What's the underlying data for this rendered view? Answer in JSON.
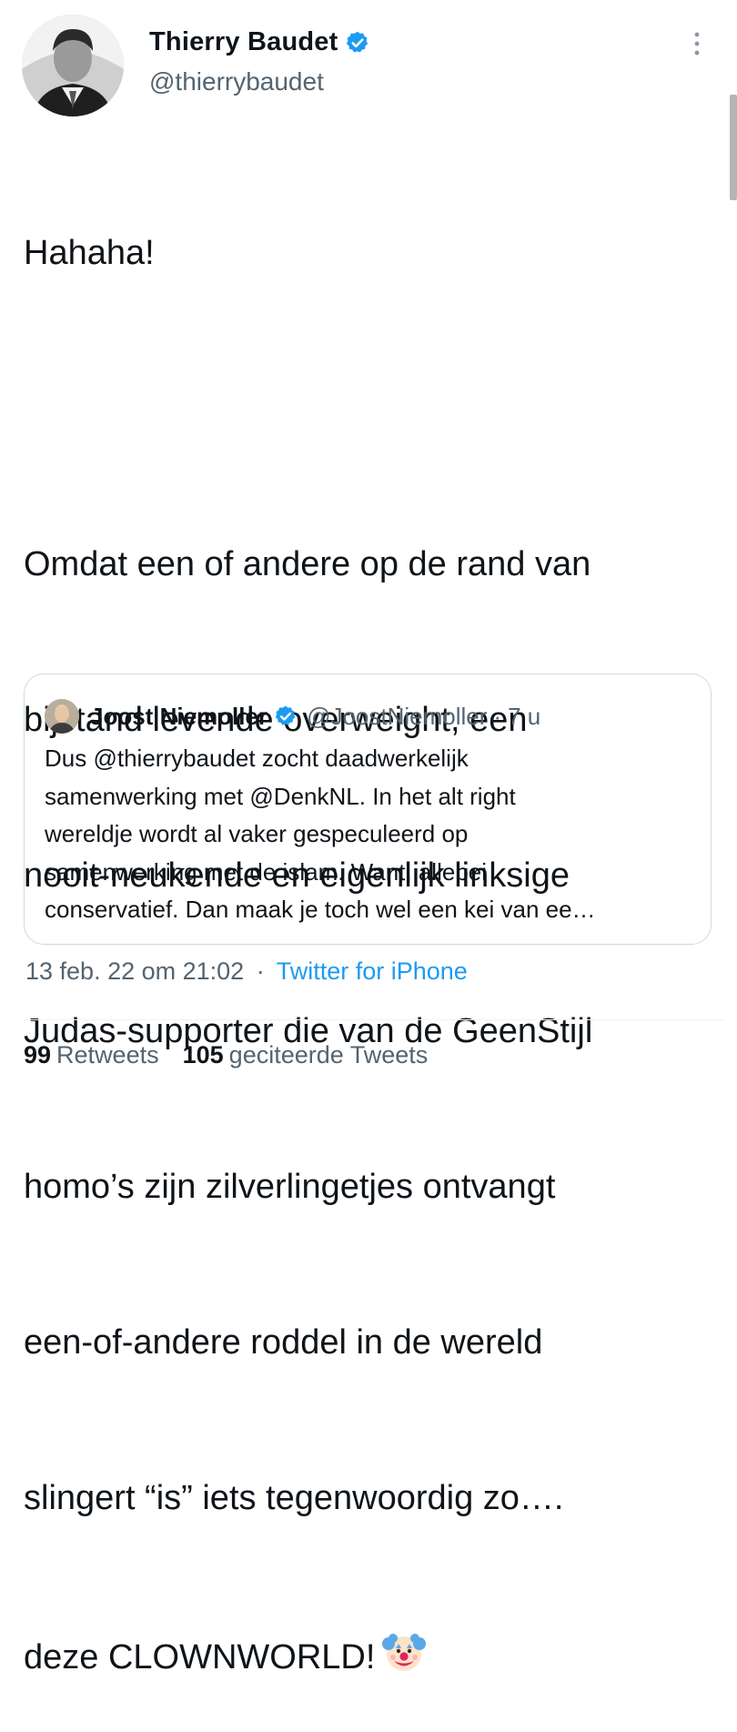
{
  "author": {
    "name": "Thierry Baudet",
    "handle": "@thierrybaudet",
    "verified": true,
    "avatar_icon": "profile-photo"
  },
  "tweet": {
    "lines": [
      "Hahaha!",
      "",
      "Omdat een of andere op de rand van",
      "bijstand levende overweight, een",
      "nooit-neukende en eigenlijk linksige",
      "Judas-supporter die van de GeenStijl",
      "homo’s zijn zilverlingetjes ontvangt",
      "een-of-andere roddel in de wereld",
      "slingert “is” iets tegenwoordig zo….",
      "deze CLOWNWORLD!"
    ],
    "emoji": "clown-face-icon"
  },
  "quote": {
    "name": "Joost Niemoller",
    "handle": "@JoostNiemoller",
    "separator": "·",
    "time": "7 u",
    "lines": [
      "Dus @thierrybaudet zocht daadwerkelijk",
      "samenwerking met @DenkNL. In het alt right",
      "wereldje wordt al vaker gespeculeerd op",
      "samenwerking met de islam. Want, allebei",
      "conservatief. Dan maak je toch wel een kei van ee…"
    ]
  },
  "meta": {
    "timestamp": "13 feb. 22 om 21:02",
    "separator": "·",
    "source": "Twitter for iPhone"
  },
  "stats": {
    "retweets_count": "99",
    "retweets_label": "Retweets",
    "quotes_count": "105",
    "quotes_label": "geciteerde Tweets"
  },
  "colors": {
    "accent": "#1d9bf0",
    "text": "#0f1419",
    "secondary": "#536471",
    "border": "#cfd9de"
  }
}
